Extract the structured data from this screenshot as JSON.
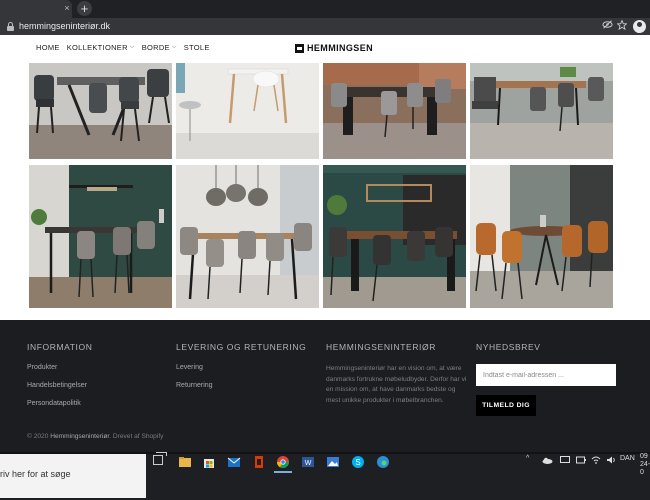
{
  "browser": {
    "tab_close": "×",
    "new_tab": "+",
    "url": "hemmingseninteriør.dk",
    "icons": [
      "lock-icon",
      "eye-slash-icon",
      "star-icon",
      "profile-icon"
    ]
  },
  "header": {
    "nav": [
      {
        "label": "HOME",
        "has_menu": false
      },
      {
        "label": "KOLLEKTIONER",
        "has_menu": true
      },
      {
        "label": "BORDE",
        "has_menu": true
      },
      {
        "label": "STOLE",
        "has_menu": false
      }
    ],
    "chevron": "⌵",
    "logo_text": "HEMMINGSEN"
  },
  "gallery": {
    "images": [
      "dining-set-dark-chairs-grey-table",
      "white-table-wooden-legs",
      "dark-table-brick-wall-grey-chairs",
      "bench-table-grey-chairs",
      "bar-table-green-wall",
      "table-pendant-lamps-white-room",
      "dark-table-green-wall-shelf",
      "cognac-chairs-round-table"
    ]
  },
  "footer": {
    "information": {
      "heading": "INFORMATION",
      "links": [
        "Produkter",
        "Handelsbetingelser",
        "Persondatapolitik"
      ]
    },
    "delivery": {
      "heading": "LEVERING OG RETUNERING",
      "links": [
        "Levering",
        "Returnering"
      ]
    },
    "about": {
      "heading": "HEMMINGSENINTERIØR",
      "text": "Hemmingseninteriør har en vision om, at være danmarks fortrukne møbeludbyder. Derfor har vi en mission om, at have danmarks bedste og mest unikke produkter i møbelbranchen."
    },
    "newsletter": {
      "heading": "NYHEDSBREV",
      "placeholder": "Indtast e-mail-adressen ...",
      "button": "TILMELD DIG"
    },
    "copyright_prefix": "© 2020 ",
    "copyright_brand": "Hemmingseninteriør",
    "copyright_suffix": ". Drevet af Shopify"
  },
  "taskbar": {
    "search_text": "riv her for at søge",
    "language": "DAN",
    "clock_time": "09",
    "clock_date": "24-0"
  }
}
